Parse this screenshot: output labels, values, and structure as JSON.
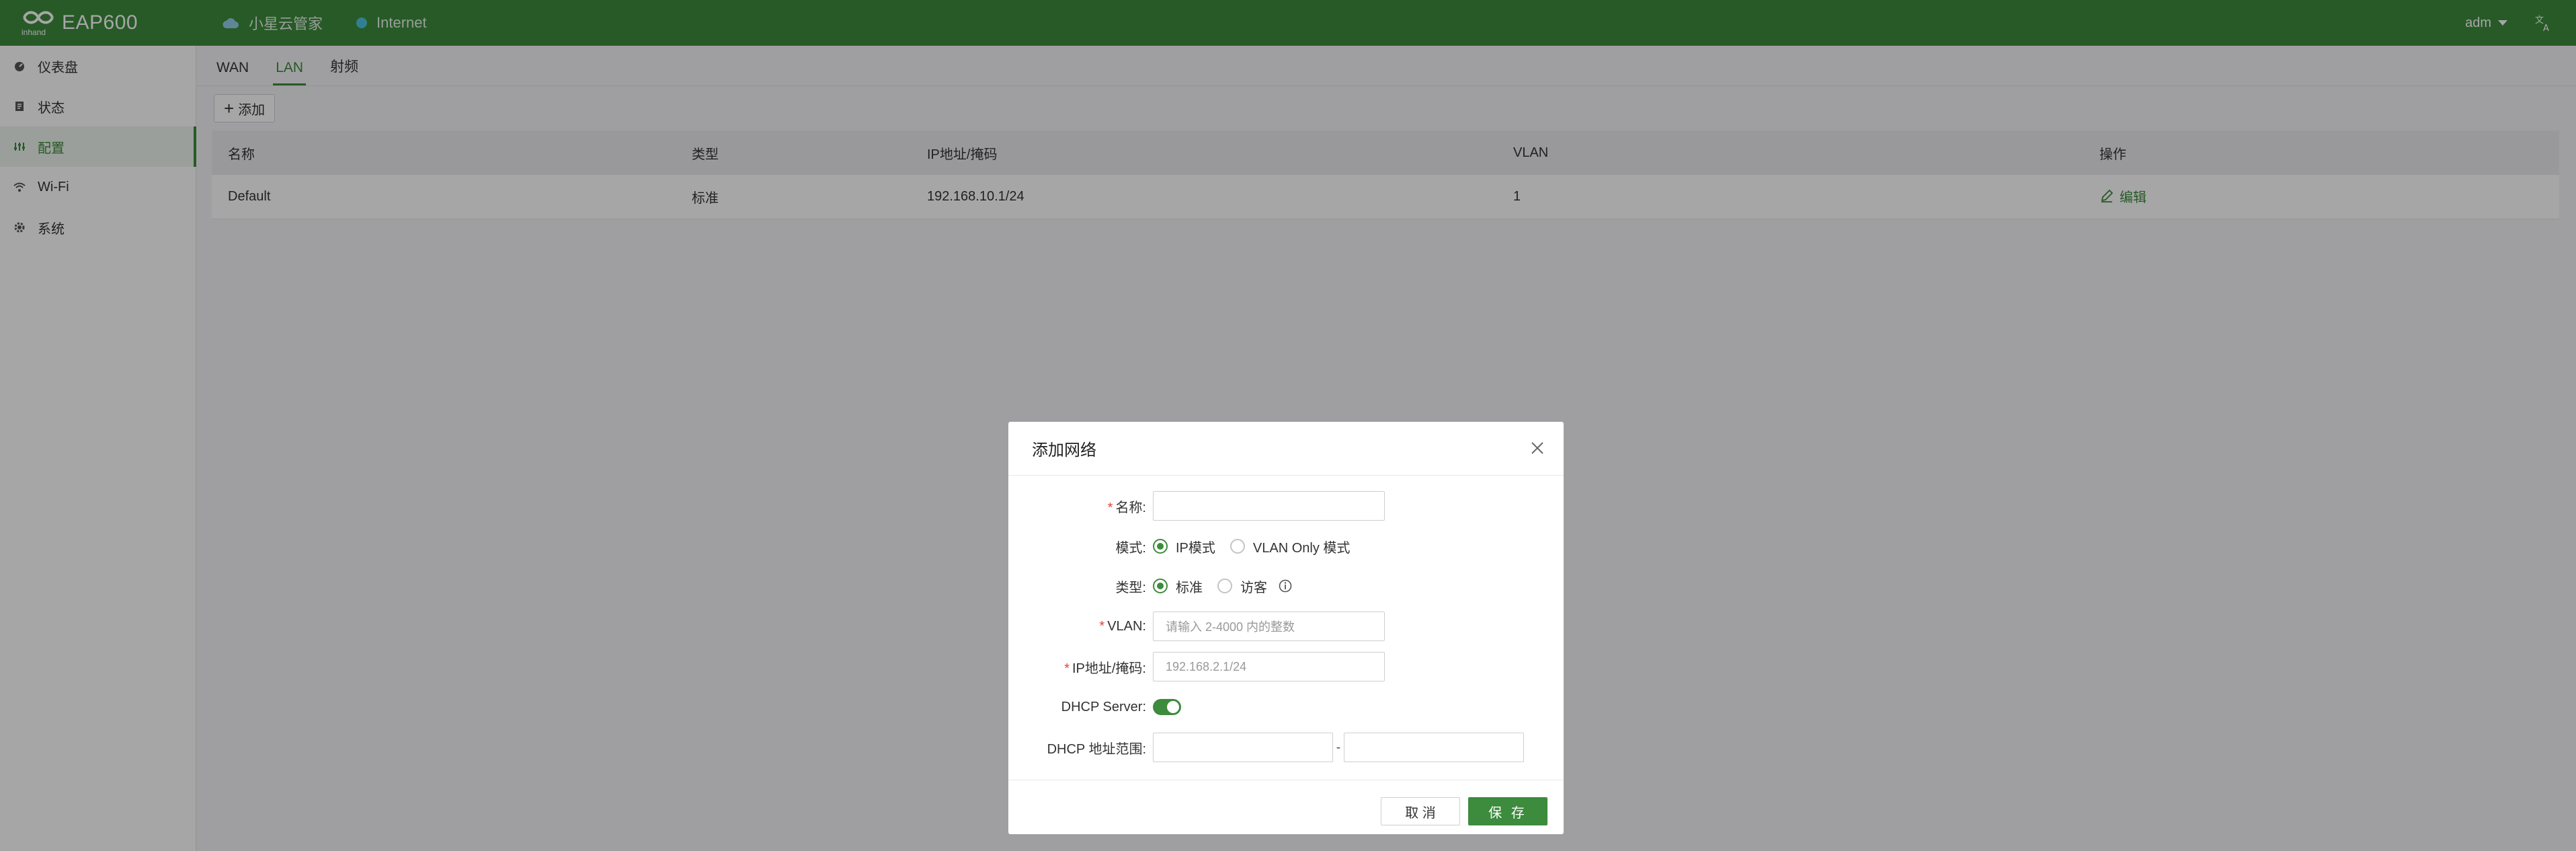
{
  "header": {
    "brand_logo_text": "inhand",
    "brand_name": "EAP600",
    "cloud_label": "小星云管家",
    "internet_label": "Internet",
    "user": "adm",
    "icons": {
      "cloud": "cloud-icon",
      "status": "status-dot",
      "language": "translate-icon"
    },
    "colors": {
      "header_bg": "#3d8b3d",
      "status_dot": "#4ec3e0"
    }
  },
  "sidebar": {
    "items": [
      {
        "label": "仪表盘",
        "icon": "dashboard-icon"
      },
      {
        "label": "状态",
        "icon": "status-icon"
      },
      {
        "label": "配置",
        "icon": "config-icon",
        "active": true
      },
      {
        "label": "Wi-Fi",
        "icon": "wifi-icon"
      },
      {
        "label": "系统",
        "icon": "gear-icon"
      }
    ]
  },
  "main": {
    "tabs": [
      {
        "label": "WAN"
      },
      {
        "label": "LAN",
        "active": true
      },
      {
        "label": "射频"
      }
    ],
    "add_label": "添加",
    "table": {
      "columns": [
        "名称",
        "类型",
        "IP地址/掩码",
        "VLAN",
        "操作"
      ],
      "rows": [
        {
          "name": "Default",
          "type": "标准",
          "ip": "192.168.10.1/24",
          "vlan": "1",
          "action": "编辑"
        }
      ]
    }
  },
  "modal": {
    "title": "添加网络",
    "fields": {
      "name_label": "名称:",
      "name_value": "",
      "mode_label": "模式:",
      "mode_options": [
        "IP模式",
        "VLAN Only 模式"
      ],
      "mode_selected": "IP模式",
      "type_label": "类型:",
      "type_options": [
        "标准",
        "访客"
      ],
      "type_selected": "标准",
      "vlan_label": "VLAN:",
      "vlan_placeholder": "请输入 2-4000 内的整数",
      "ip_label": "IP地址/掩码:",
      "ip_placeholder": "192.168.2.1/24",
      "dhcp_label": "DHCP Server:",
      "dhcp_enabled": true,
      "range_label": "DHCP 地址范围:",
      "range_start": "",
      "range_end": "",
      "range_sep": "-"
    },
    "cancel_label": "取 消",
    "save_label": "保 存"
  }
}
